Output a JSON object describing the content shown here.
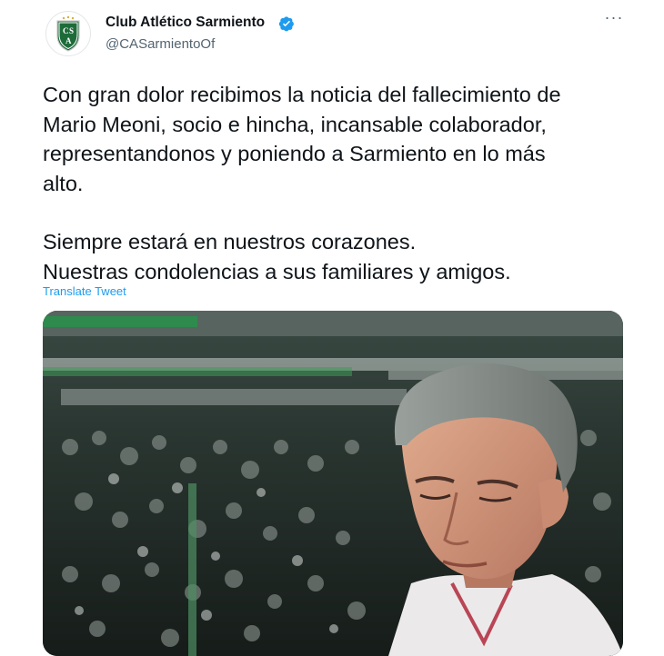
{
  "author": {
    "name": "Club Atlético Sarmiento",
    "handle": "@CASarmientoOf",
    "avatar_letters": "CSA",
    "verified": true
  },
  "icons": {
    "verified": "verified-badge-icon",
    "more": "more-options-icon"
  },
  "tweet": {
    "paragraph_1_line_1": "Con gran dolor recibimos la noticia del fallecimiento de",
    "paragraph_1_line_2": "Mario Meoni, socio  e hincha, incansable colaborador,",
    "paragraph_1_line_3": "representandonos y poniendo a Sarmiento en lo más",
    "paragraph_1_line_4": "alto.",
    "paragraph_2_line_1": "Siempre estará en nuestros corazones.",
    "paragraph_2_line_2": "Nuestras condolencias a sus familiares y amigos.",
    "translate_label": "Translate Tweet"
  },
  "more_glyph": "···",
  "colors": {
    "text_primary": "#0f1419",
    "text_secondary": "#536471",
    "link": "#1d9bf0",
    "brand_green": "#1e6b3a"
  }
}
